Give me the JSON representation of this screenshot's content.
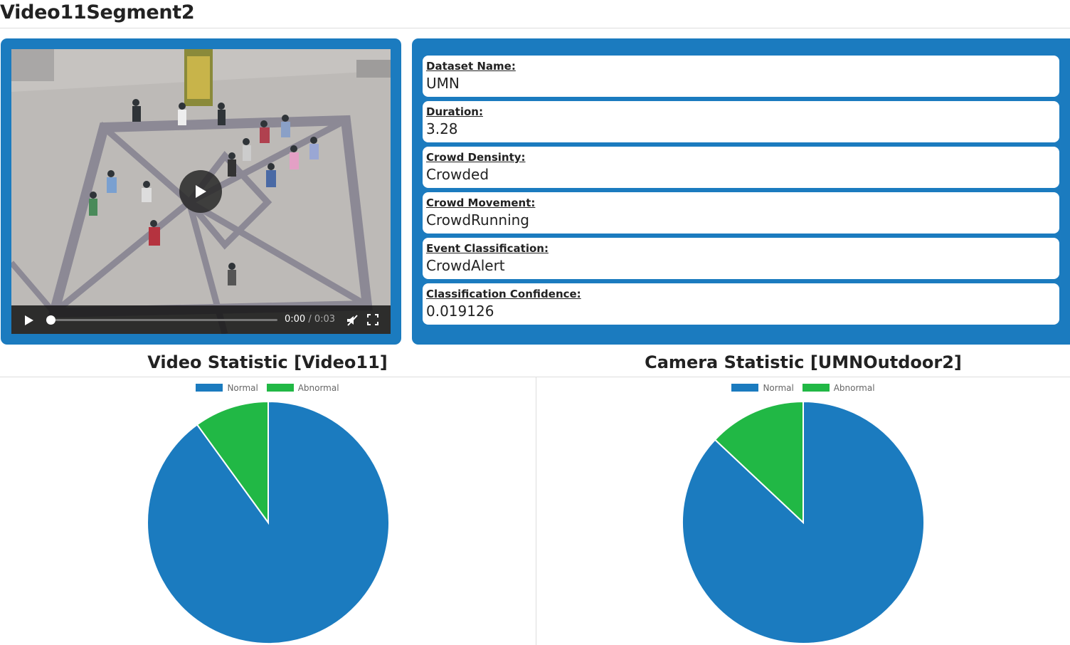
{
  "page": {
    "title": "Video11Segment2"
  },
  "video": {
    "current_time": "0:00",
    "separator": "/",
    "duration": "0:03",
    "progress": 0
  },
  "info": [
    {
      "label": "Dataset Name:",
      "value": "UMN"
    },
    {
      "label": "Duration:",
      "value": "3.28"
    },
    {
      "label": "Crowd Densinty:",
      "value": "Crowded"
    },
    {
      "label": "Crowd Movement:",
      "value": "CrowdRunning"
    },
    {
      "label": "Event Classification:",
      "value": "CrowdAlert"
    },
    {
      "label": "Classification Confidence:",
      "value": "0.019126"
    }
  ],
  "colors": {
    "panel": "#1b7bbf",
    "normal": "#1b7bbf",
    "abnormal": "#21b845"
  },
  "chart_data": [
    {
      "type": "pie",
      "title": "Video Statistic [Video11]",
      "legend": [
        "Normal",
        "Abnormal"
      ],
      "legend_position": "top",
      "values": [
        90,
        10
      ],
      "colors": [
        "#1b7bbf",
        "#21b845"
      ]
    },
    {
      "type": "pie",
      "title": "Camera Statistic [UMNOutdoor2]",
      "legend": [
        "Normal",
        "Abnormal"
      ],
      "legend_position": "top",
      "values": [
        87,
        13
      ],
      "colors": [
        "#1b7bbf",
        "#21b845"
      ]
    }
  ]
}
